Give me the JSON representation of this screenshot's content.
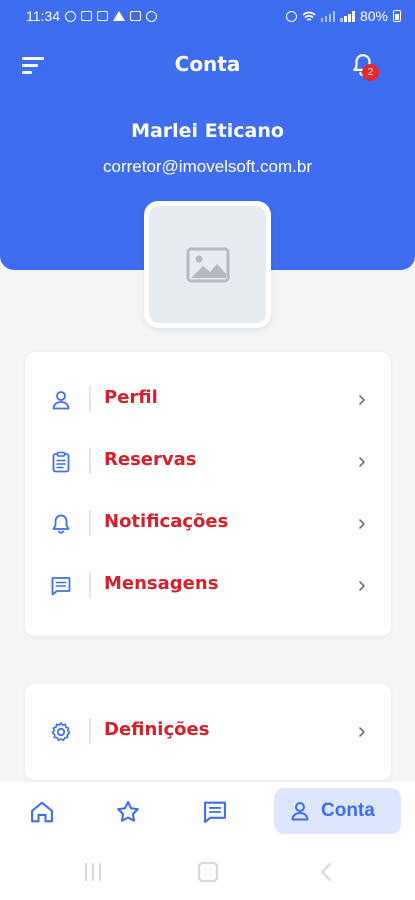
{
  "status_bar": {
    "time": "11:34",
    "battery": "80%",
    "icons": [
      "whatsapp-icon",
      "image-icon",
      "image-icon",
      "warning-icon",
      "gallery-icon",
      "accessibility-icon",
      "alarm-icon",
      "wifi-icon",
      "volte-icon",
      "signal-icon",
      "signal-icon",
      "battery-icon"
    ]
  },
  "header": {
    "title": "Conta",
    "menu_icon": "menu-icon",
    "notifications_icon": "bell-icon",
    "notifications_count": "2",
    "user_name": "Marlei Eticano",
    "user_email": "corretor@imovelsoft.com.br",
    "avatar_icon": "image-placeholder-icon"
  },
  "menu": {
    "items": [
      {
        "label": "Perfil",
        "icon": "user-icon"
      },
      {
        "label": "Reservas",
        "icon": "clipboard-icon"
      },
      {
        "label": "Notificações",
        "icon": "bell-icon"
      },
      {
        "label": "Mensagens",
        "icon": "message-icon"
      }
    ]
  },
  "settings": {
    "items": [
      {
        "label": "Definições",
        "icon": "gear-icon"
      }
    ]
  },
  "bottom_nav": {
    "items": [
      {
        "icon": "home-icon"
      },
      {
        "icon": "star-icon"
      },
      {
        "icon": "message-icon"
      },
      {
        "icon": "user-icon",
        "label": "Conta",
        "active": true
      }
    ]
  },
  "colors": {
    "primary": "#3f6df0",
    "label_red": "#d6202a",
    "badge_red": "#e8262d",
    "active_tab_bg": "#dde6fd"
  }
}
